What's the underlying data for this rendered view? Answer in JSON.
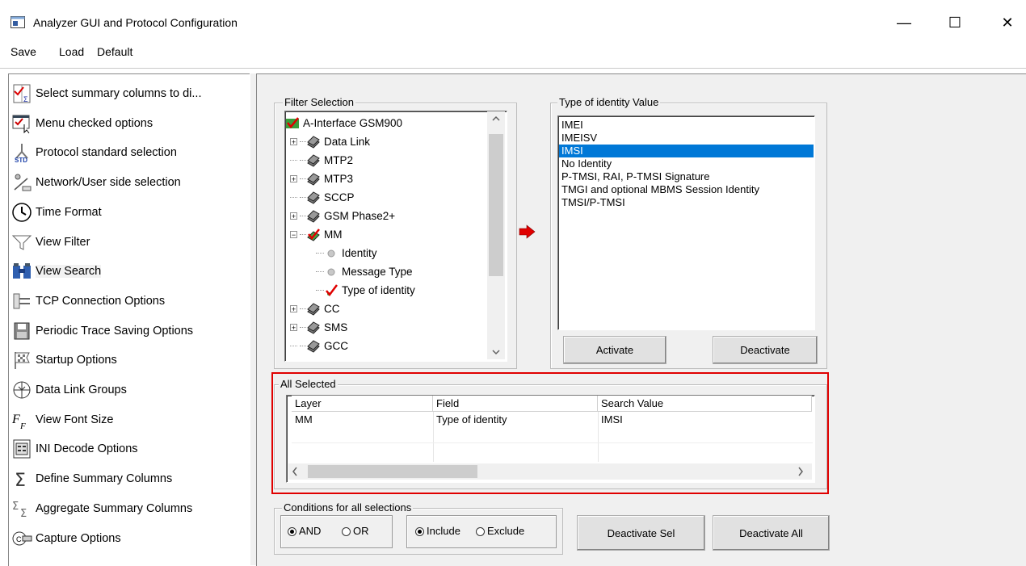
{
  "window": {
    "title": "Analyzer GUI and Protocol Configuration",
    "minimize_glyph": "—",
    "maximize_glyph": "☐",
    "close_glyph": "✕"
  },
  "menu": {
    "items": [
      "Save",
      "Load",
      "Default"
    ]
  },
  "sidebar": {
    "items": [
      {
        "label": "Select summary columns to di...",
        "icon": "columns-select-icon"
      },
      {
        "label": "Menu checked options",
        "icon": "menu-checked-icon"
      },
      {
        "label": "Protocol standard selection",
        "icon": "protocol-standard-icon"
      },
      {
        "label": "Network/User side selection",
        "icon": "network-user-icon"
      },
      {
        "label": "Time Format",
        "icon": "clock-icon"
      },
      {
        "label": "View Filter",
        "icon": "funnel-icon"
      },
      {
        "label": "View Search",
        "icon": "binoculars-icon"
      },
      {
        "label": "TCP Connection Options",
        "icon": "tcp-connection-icon"
      },
      {
        "label": "Periodic Trace Saving Options",
        "icon": "save-trace-icon"
      },
      {
        "label": "Startup Options",
        "icon": "flag-icon"
      },
      {
        "label": "Data Link Groups",
        "icon": "data-link-groups-icon"
      },
      {
        "label": "View Font Size",
        "icon": "font-size-icon"
      },
      {
        "label": "INI Decode Options",
        "icon": "ini-decode-icon"
      },
      {
        "label": "Define Summary Columns",
        "icon": "sigma-icon"
      },
      {
        "label": "Aggregate Summary Columns",
        "icon": "aggregate-sigma-icon"
      },
      {
        "label": "Capture Options",
        "icon": "capture-icon"
      }
    ],
    "selected_index": 6
  },
  "filter_selection": {
    "label": "Filter Selection",
    "tree": [
      {
        "label": "A-Interface GSM900",
        "level": 0,
        "expander": "",
        "icon": "checked-root-icon"
      },
      {
        "label": "Data Link",
        "level": 1,
        "expander": "+",
        "icon": "layer-icon"
      },
      {
        "label": "MTP2",
        "level": 1,
        "expander": "",
        "icon": "layer-icon"
      },
      {
        "label": "MTP3",
        "level": 1,
        "expander": "+",
        "icon": "layer-icon"
      },
      {
        "label": "SCCP",
        "level": 1,
        "expander": "",
        "icon": "layer-icon"
      },
      {
        "label": "GSM Phase2+",
        "level": 1,
        "expander": "+",
        "icon": "layer-icon"
      },
      {
        "label": "MM",
        "level": 1,
        "expander": "−",
        "icon": "checked-layer-icon"
      },
      {
        "label": "Identity",
        "level": 2,
        "expander": "",
        "icon": "grey-dot-icon"
      },
      {
        "label": "Message Type",
        "level": 2,
        "expander": "",
        "icon": "grey-dot-icon"
      },
      {
        "label": "Type of identity",
        "level": 2,
        "expander": "",
        "icon": "red-check-icon"
      },
      {
        "label": "CC",
        "level": 1,
        "expander": "+",
        "icon": "layer-icon"
      },
      {
        "label": "SMS",
        "level": 1,
        "expander": "+",
        "icon": "layer-icon"
      },
      {
        "label": "GCC",
        "level": 1,
        "expander": "",
        "icon": "layer-icon"
      }
    ]
  },
  "value_box": {
    "label": "Type of identity Value",
    "items": [
      "IMEI",
      "IMEISV",
      "IMSI",
      "No Identity",
      "P-TMSI, RAI, P-TMSI Signature",
      "TMGI and optional MBMS Session Identity",
      "TMSI/P-TMSI"
    ],
    "selected_index": 2,
    "activate_label": "Activate",
    "deactivate_label": "Deactivate"
  },
  "all_selected": {
    "label": "All Selected",
    "columns": [
      "Layer",
      "Field",
      "Search Value"
    ],
    "rows": [
      [
        "MM",
        "Type of identity",
        "IMSI"
      ]
    ]
  },
  "conditions": {
    "label": "Conditions for all selections",
    "and_label": "AND",
    "or_label": "OR",
    "include_label": "Include",
    "exclude_label": "Exclude",
    "and_selected": true,
    "include_selected": true
  },
  "buttons": {
    "deactivate_sel": "Deactivate Sel",
    "deactivate_all": "Deactivate All"
  },
  "colors": {
    "highlight": "#0078d7",
    "annotation_red": "#e00000"
  }
}
